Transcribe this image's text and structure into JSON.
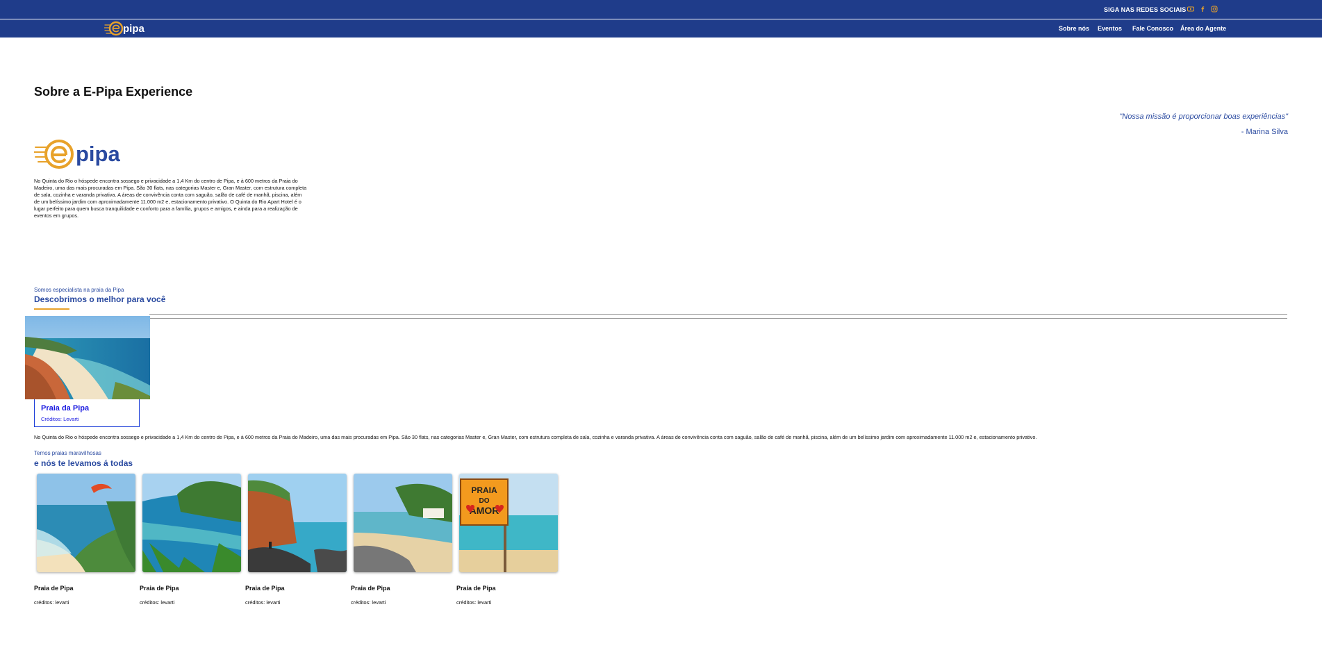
{
  "header": {
    "social_label": "SIGA NAS REDES SOCIAIS",
    "social_icons": [
      "youtube-icon",
      "facebook-icon",
      "instagram-icon"
    ],
    "logo_text": "pipa",
    "nav": [
      "Sobre nós",
      "Eventos",
      "Fale Conosco",
      "Área do Agente"
    ]
  },
  "about": {
    "title": "Sobre a E-Pipa Experience",
    "quote": "\"Nossa missão é proporcionar boas experiências\"",
    "quote_author": "- Marina Silva",
    "logo_text": "pipa",
    "text": "No Quinta do Rio o hóspede encontra sossego e privacidade a 1,4 Km do centro de Pipa, e à 600 metros da Praia do Madeiro, uma das mais procuradas em Pipa. São 30 flats, nas categorias Master e, Gran Master, com estrutura completa de sala, cozinha e varanda privativa. A áreas de convivência conta com saguão, salão de café de manhã, piscina, além de um belíssimo jardim com aproximadamente 11.000 m2 e, estacionamento privativo. O Quinta do Rio Apart Hotel é o lugar perfeito para quem busca tranquilidade e conforto para a família, grupos e amigos, e ainda para a realização de eventos em grupos."
  },
  "specialist": {
    "subtitle": "Somos especialista na praia da Pipa",
    "title": "Descobrimos o melhor para você",
    "feature": {
      "title": "Praia da Pipa",
      "credit": "Créditos: Levarti"
    },
    "text": "No Quinta do Rio o hóspede encontra sossego e privacidade a 1,4 Km do centro de Pipa, e à 600 metros da Praia do Madeiro, uma das mais procuradas em Pipa. São 30 flats, nas categorias Master e, Gran Master, com estrutura completa de sala, cozinha e varanda privativa. A áreas de convivência conta com saguão, salão de café de manhã, piscina, além de um belíssimo jardim com aproximadamente 11.000 m2 e, estacionamento privativo."
  },
  "beaches": {
    "subtitle": "Temos praias maravilhosas",
    "title": "e nós te levamos á todas",
    "sign_text": [
      "PRAIA",
      "DO",
      "AMOR"
    ],
    "items": [
      {
        "name": "Praia de Pipa",
        "credit": "créditos: levarti"
      },
      {
        "name": "Praia de Pipa",
        "credit": "créditos: levarti"
      },
      {
        "name": "Praia de Pipa",
        "credit": "créditos: levarti"
      },
      {
        "name": "Praia de Pipa",
        "credit": "créditos: levarti"
      },
      {
        "name": "Praia de Pipa",
        "credit": "créditos: levarti"
      }
    ]
  },
  "colors": {
    "brand_blue": "#1f3c8a",
    "accent_orange": "#e8a22a",
    "link_blue": "#2a4aa0"
  }
}
